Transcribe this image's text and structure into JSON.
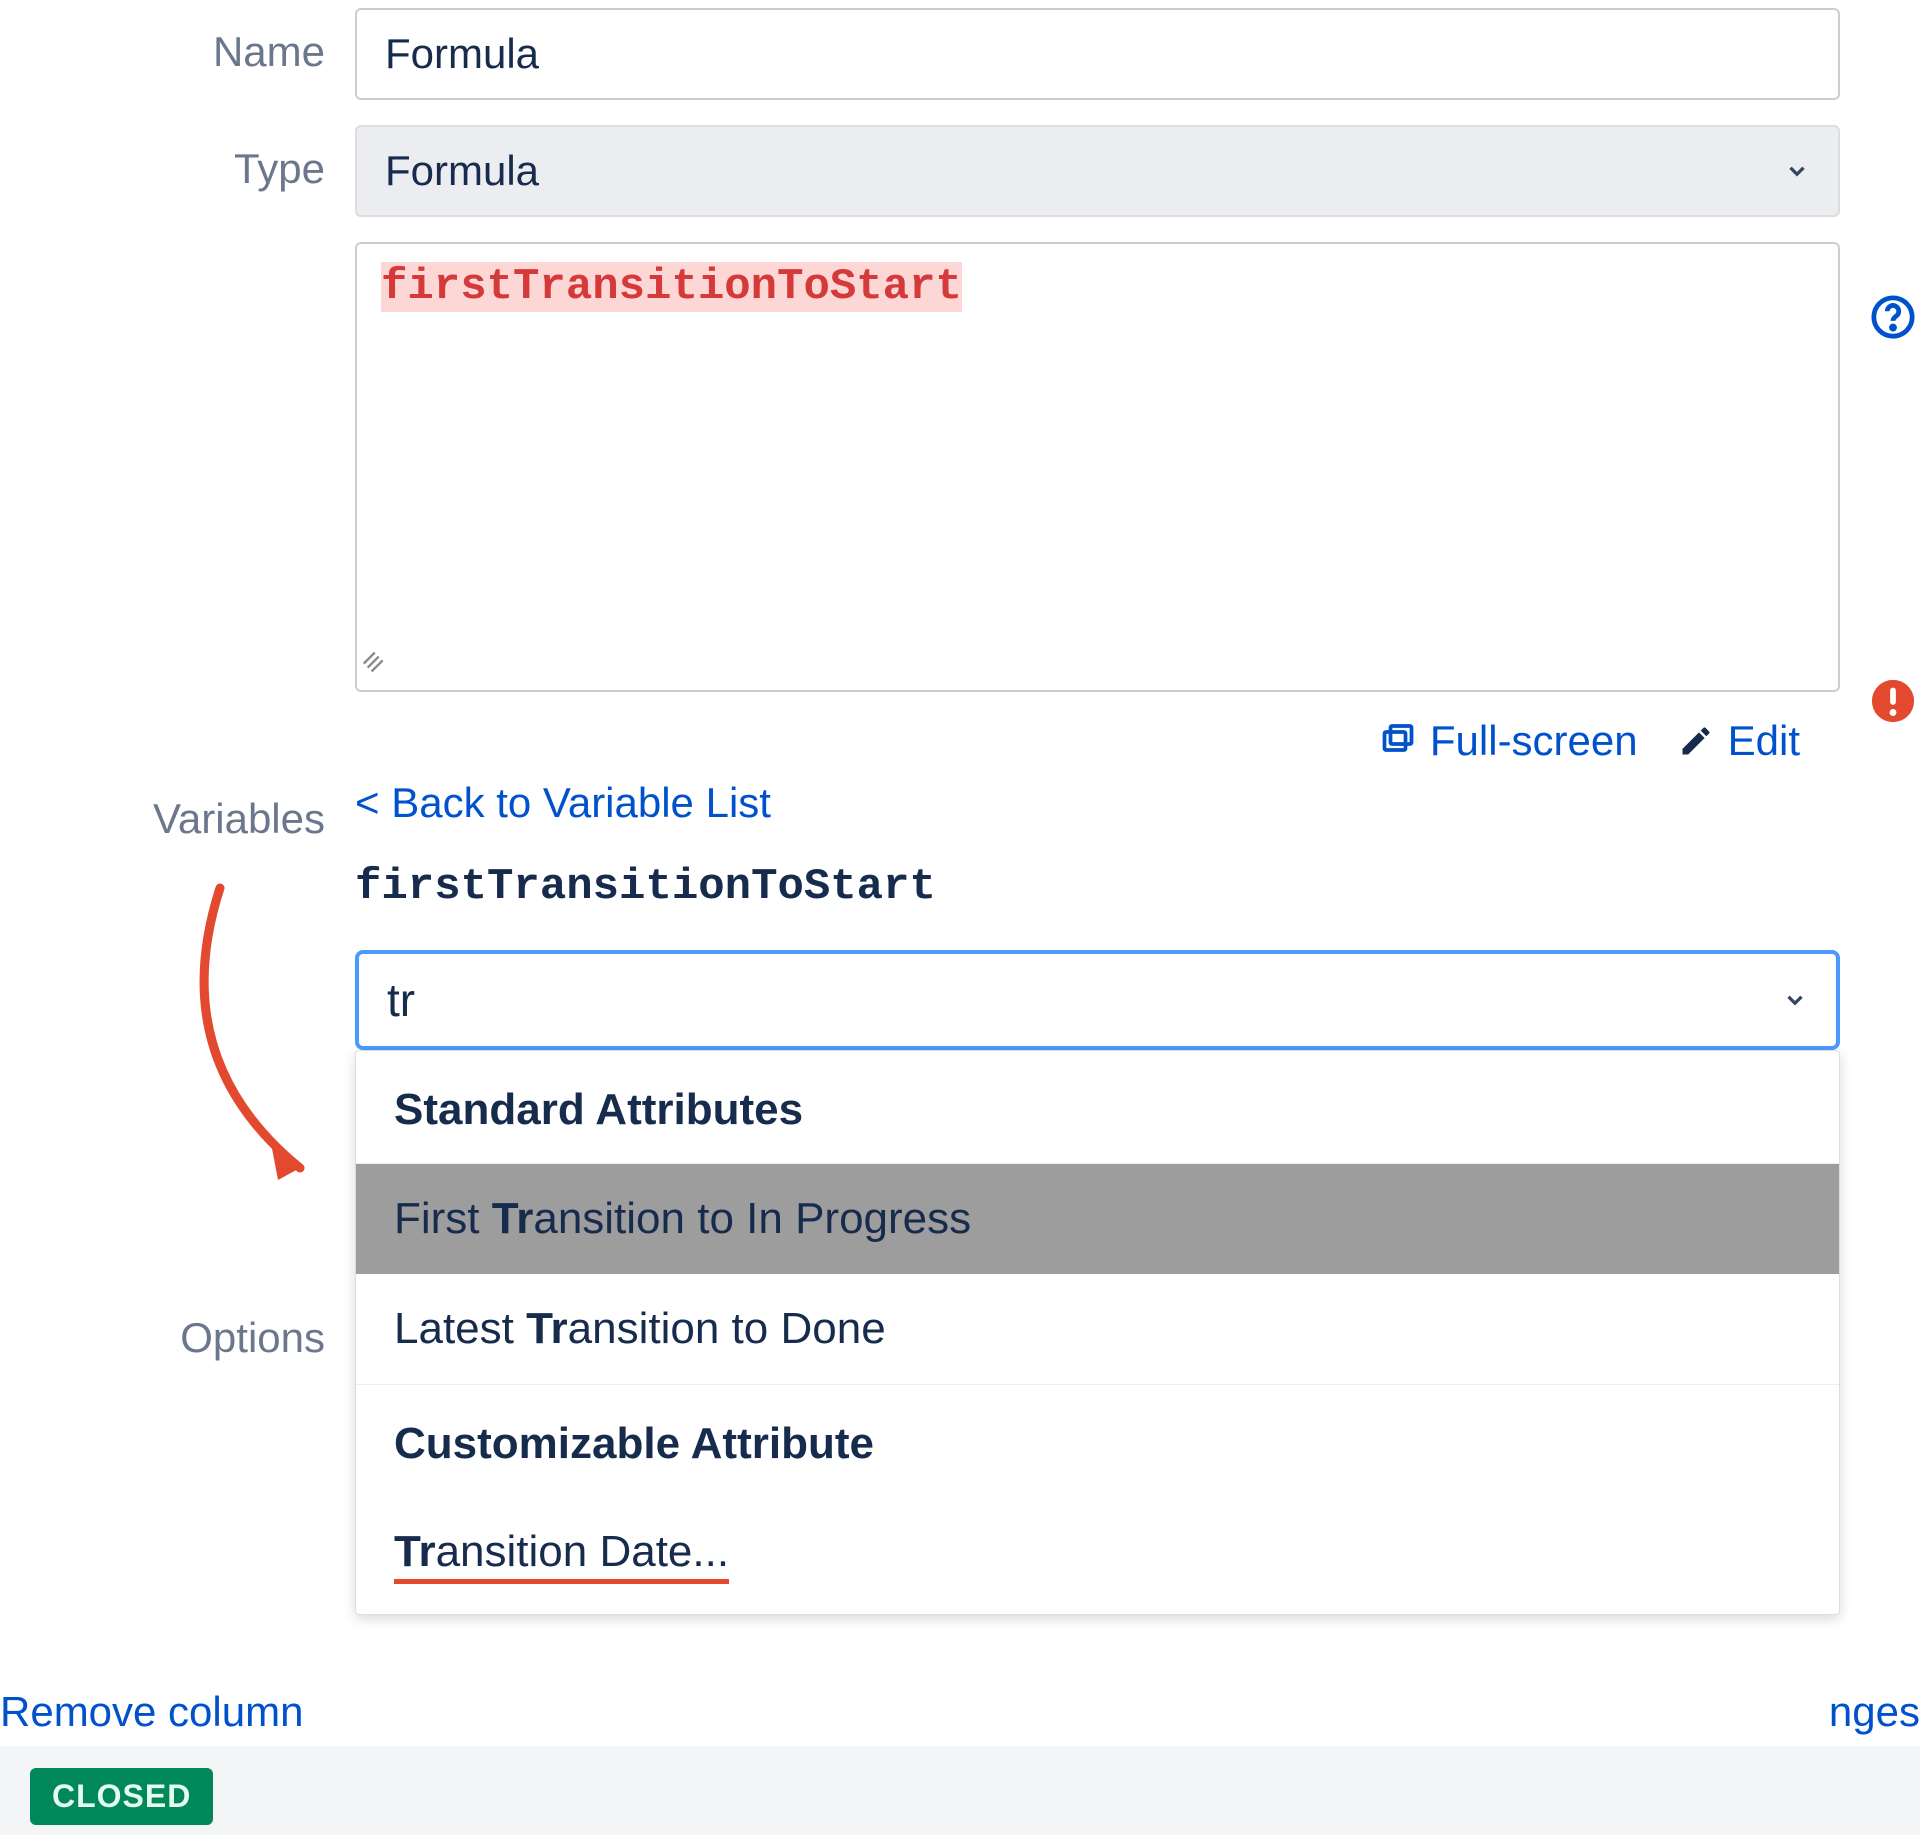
{
  "form": {
    "name_label": "Name",
    "name_value": "Formula",
    "type_label": "Type",
    "type_value": "Formula",
    "formula_text": "firstTransitionToStart",
    "variables_label": "Variables",
    "options_label": "Options"
  },
  "actions": {
    "fullscreen": "Full-screen",
    "edit": "Edit"
  },
  "variables": {
    "back_link": "< Back to Variable List",
    "current_name": "firstTransitionToStart",
    "search_value": "tr"
  },
  "dropdown": {
    "section1_header": "Standard Attributes",
    "items1": [
      {
        "prefix": "First ",
        "match": "Tr",
        "suffix": "ansition to In Progress",
        "highlighted": true
      },
      {
        "prefix": "Latest ",
        "match": "Tr",
        "suffix": "ansition to Done",
        "highlighted": false
      }
    ],
    "section2_header": "Customizable Attribute",
    "item2": {
      "match": "Tr",
      "suffix": "ansition Date..."
    }
  },
  "footer": {
    "remove": "Remove column",
    "nges": "nges",
    "closed": "CLOSED"
  }
}
